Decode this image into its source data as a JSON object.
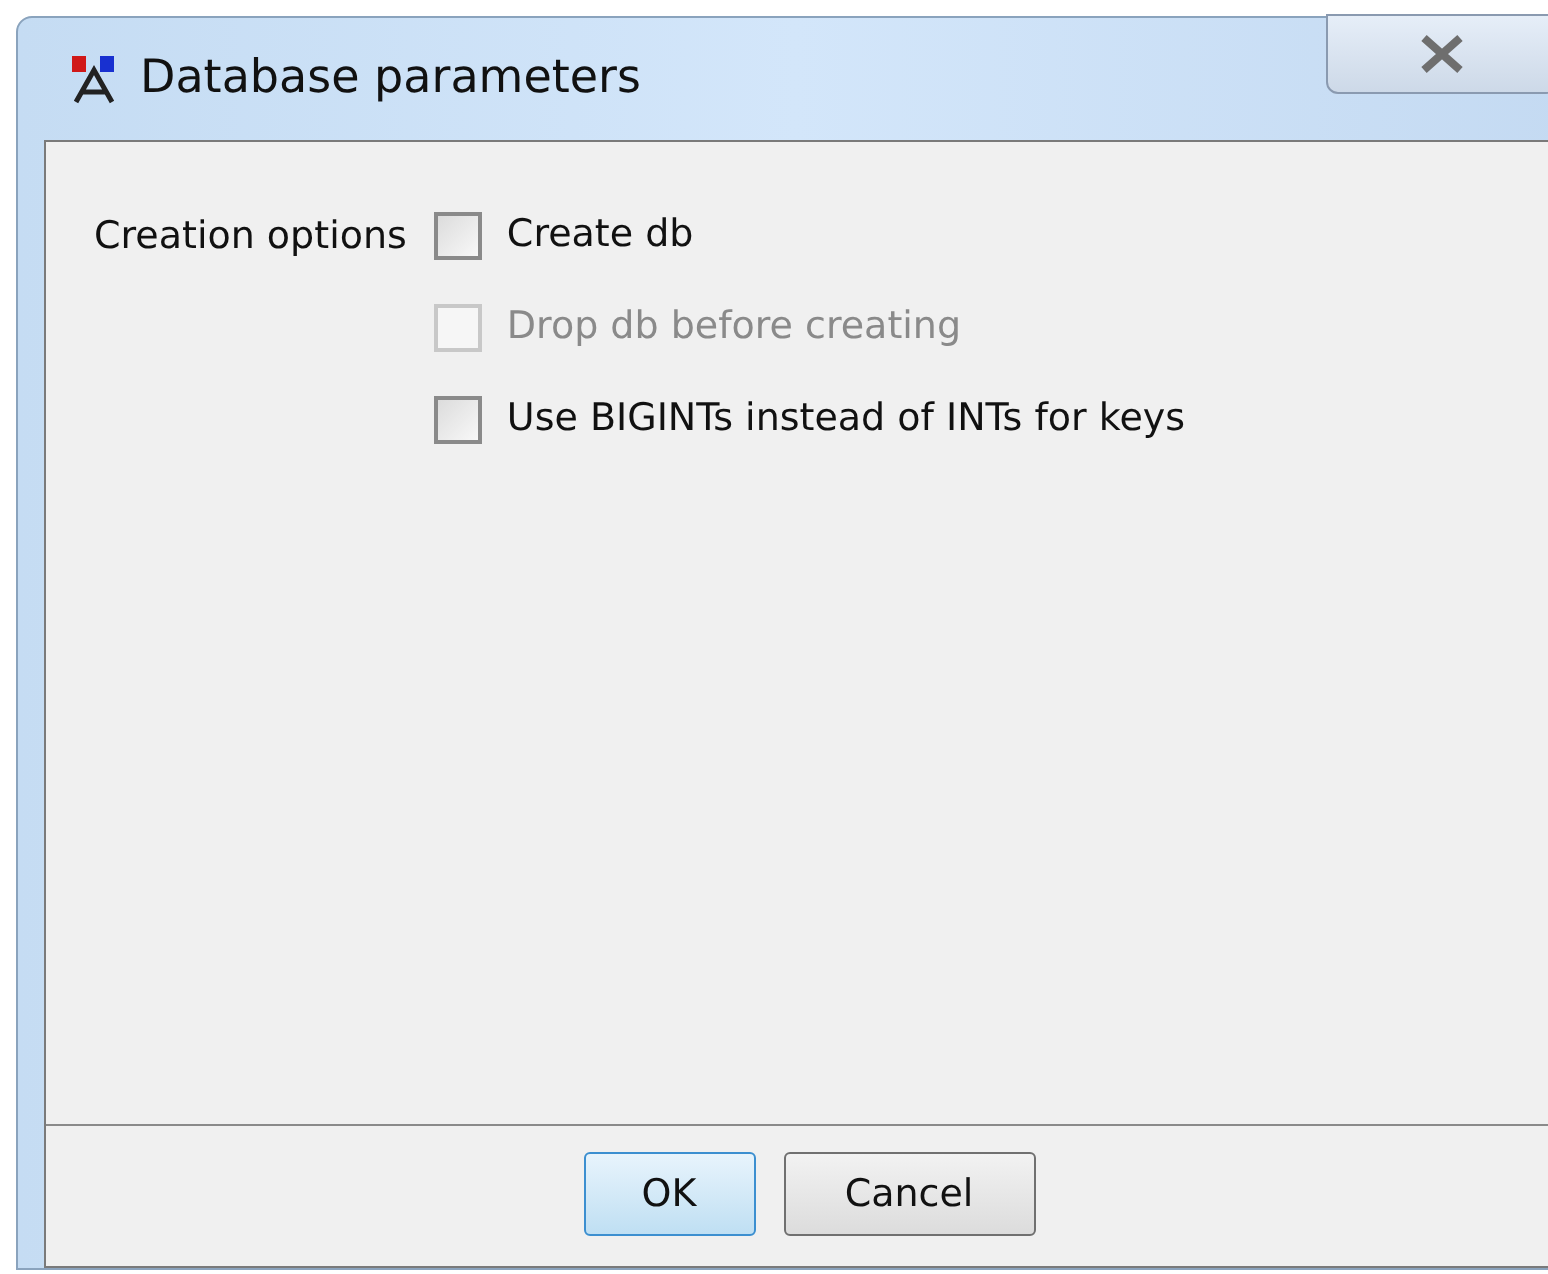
{
  "window": {
    "title": "Database parameters"
  },
  "group": {
    "label": "Creation options",
    "options": [
      {
        "label": "Create db",
        "checked": false,
        "disabled": false
      },
      {
        "label": "Drop db before creating",
        "checked": false,
        "disabled": true
      },
      {
        "label": "Use BIGINTs instead of INTs for keys",
        "checked": false,
        "disabled": false
      }
    ]
  },
  "buttons": [
    {
      "label": "OK",
      "default": true
    },
    {
      "label": "Cancel",
      "default": false
    }
  ]
}
